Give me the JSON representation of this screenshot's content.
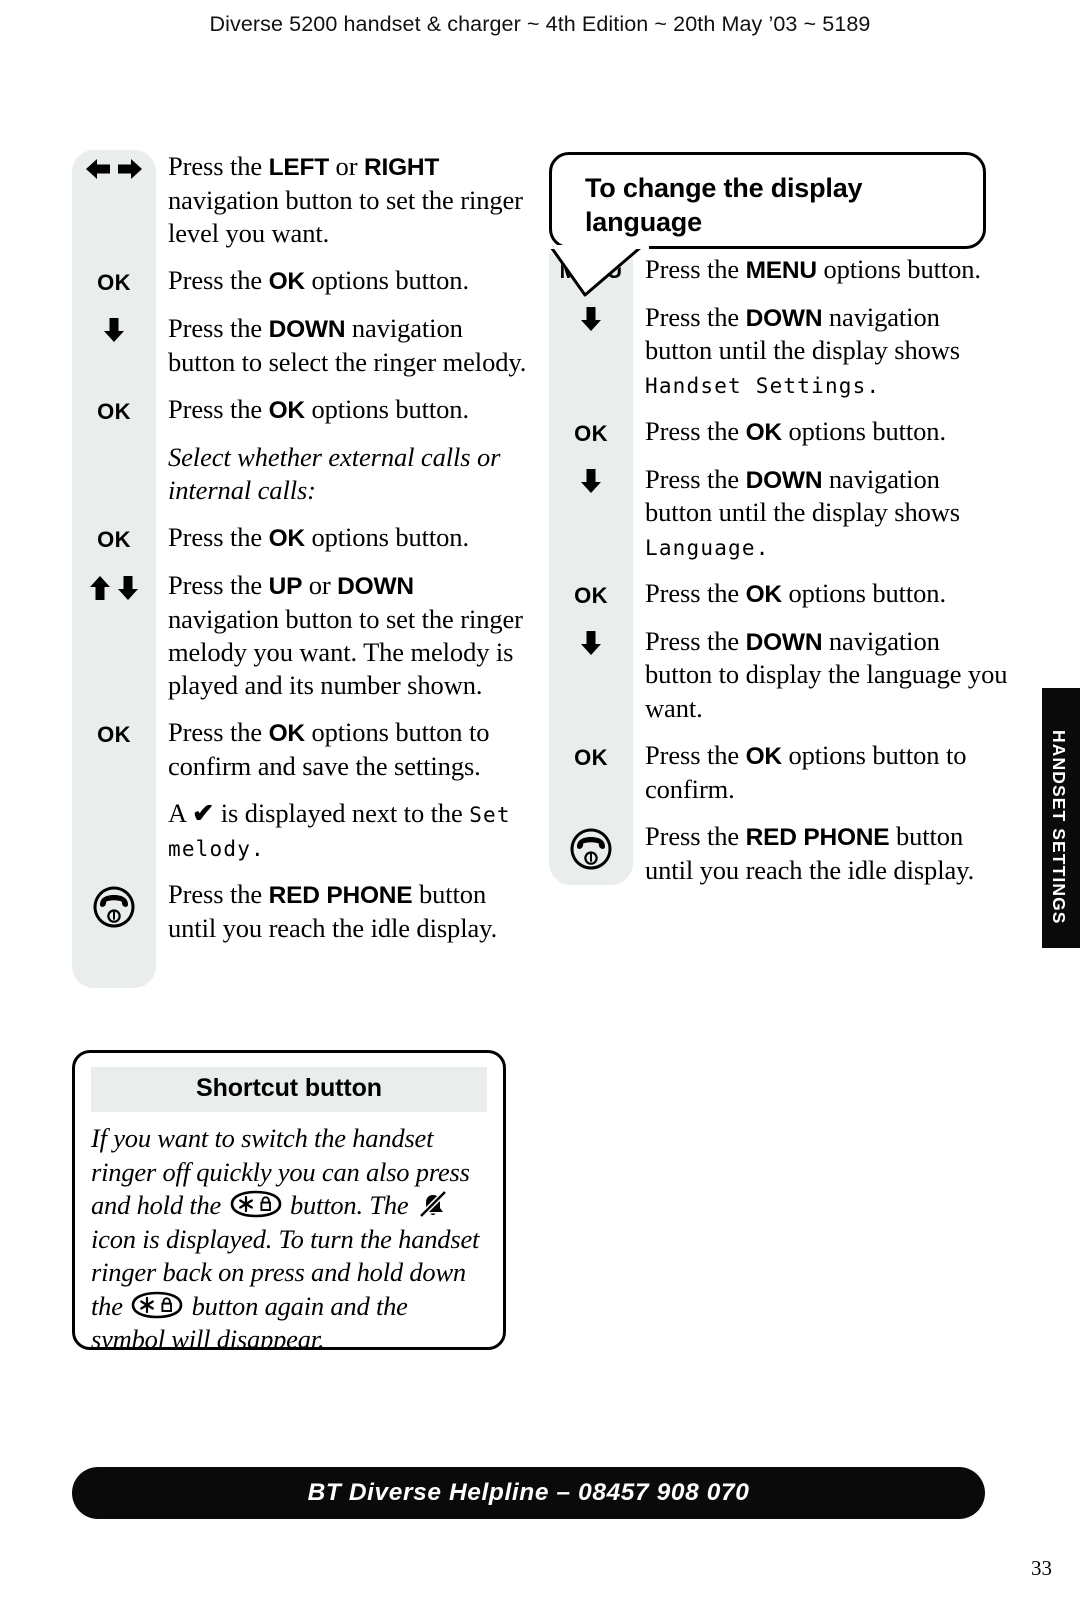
{
  "header": {
    "title": "Diverse 5200 handset & charger ~ 4th Edition ~ 20th May ’03 ~ 5189"
  },
  "side_tab": {
    "label": "HANDSET SETTINGS"
  },
  "footer": {
    "helpline": "BT Diverse Helpline – 08457 908 070",
    "page_number": "33"
  },
  "left_column": {
    "steps": [
      {
        "icon": "left-right-arrows-icon",
        "icon_label": "",
        "text_parts": [
          {
            "t": "Press the ",
            "s": "normal"
          },
          {
            "t": "LEFT",
            "s": "bold"
          },
          {
            "t": " or ",
            "s": "normal"
          },
          {
            "t": "RIGHT",
            "s": "bold"
          },
          {
            "t": " navigation button to set the ringer level you want.",
            "s": "normal"
          }
        ]
      },
      {
        "icon": "ok-label-icon",
        "icon_label": "OK",
        "text_parts": [
          {
            "t": "Press the ",
            "s": "normal"
          },
          {
            "t": "OK",
            "s": "bold"
          },
          {
            "t": " options button.",
            "s": "normal"
          }
        ]
      },
      {
        "icon": "down-arrow-icon",
        "icon_label": "",
        "text_parts": [
          {
            "t": "Press the ",
            "s": "normal"
          },
          {
            "t": "DOWN",
            "s": "bold"
          },
          {
            "t": " navigation button to select the ringer melody.",
            "s": "normal"
          }
        ]
      },
      {
        "icon": "ok-label-icon",
        "icon_label": "OK",
        "text_parts": [
          {
            "t": "Press the ",
            "s": "normal"
          },
          {
            "t": "OK",
            "s": "bold"
          },
          {
            "t": " options button.",
            "s": "normal"
          }
        ]
      },
      {
        "icon": "none",
        "icon_label": "",
        "text_parts": [
          {
            "t": "Select whether external calls or internal calls:",
            "s": "italic"
          }
        ]
      },
      {
        "icon": "ok-label-icon",
        "icon_label": "OK",
        "text_parts": [
          {
            "t": "Press the ",
            "s": "normal"
          },
          {
            "t": "OK",
            "s": "bold"
          },
          {
            "t": " options button.",
            "s": "normal"
          }
        ]
      },
      {
        "icon": "up-down-arrows-icon",
        "icon_label": "",
        "text_parts": [
          {
            "t": "Press the ",
            "s": "normal"
          },
          {
            "t": "UP",
            "s": "bold"
          },
          {
            "t": " or ",
            "s": "normal"
          },
          {
            "t": "DOWN",
            "s": "bold"
          },
          {
            "t": " navigation button to set the ringer melody you want. The melody is played and its number shown.",
            "s": "normal"
          }
        ]
      },
      {
        "icon": "ok-label-icon",
        "icon_label": "OK",
        "text_parts": [
          {
            "t": "Press the ",
            "s": "normal"
          },
          {
            "t": "OK",
            "s": "bold"
          },
          {
            "t": " options button to confirm and save the settings.",
            "s": "normal"
          }
        ]
      },
      {
        "icon": "none",
        "icon_label": "",
        "text_parts": [
          {
            "t": "A ",
            "s": "normal"
          },
          {
            "t": "✔",
            "s": "tick"
          },
          {
            "t": " is displayed next to the ",
            "s": "normal"
          },
          {
            "t": "Set melody.",
            "s": "lcd"
          }
        ]
      },
      {
        "icon": "red-phone-icon",
        "icon_label": "",
        "text_parts": [
          {
            "t": "Press the ",
            "s": "normal"
          },
          {
            "t": "RED PHONE",
            "s": "bold"
          },
          {
            "t": " button until you reach the idle display.",
            "s": "normal"
          }
        ]
      }
    ]
  },
  "right_column": {
    "callout_title": "To change the display language",
    "steps": [
      {
        "icon": "menu-label-icon",
        "icon_label": "MENU",
        "text_parts": [
          {
            "t": "Press the ",
            "s": "normal"
          },
          {
            "t": "MENU",
            "s": "bold"
          },
          {
            "t": " options button.",
            "s": "normal"
          }
        ]
      },
      {
        "icon": "down-arrow-icon",
        "icon_label": "",
        "text_parts": [
          {
            "t": "Press the ",
            "s": "normal"
          },
          {
            "t": "DOWN",
            "s": "bold"
          },
          {
            "t": " navigation button until the display shows ",
            "s": "normal"
          },
          {
            "t": "Handset Settings.",
            "s": "lcd"
          }
        ]
      },
      {
        "icon": "ok-label-icon",
        "icon_label": "OK",
        "text_parts": [
          {
            "t": "Press the ",
            "s": "normal"
          },
          {
            "t": "OK",
            "s": "bold"
          },
          {
            "t": " options button.",
            "s": "normal"
          }
        ]
      },
      {
        "icon": "down-arrow-icon",
        "icon_label": "",
        "text_parts": [
          {
            "t": "Press the ",
            "s": "normal"
          },
          {
            "t": "DOWN",
            "s": "bold"
          },
          {
            "t": " navigation button until the display shows ",
            "s": "normal"
          },
          {
            "t": "Language.",
            "s": "lcd"
          }
        ]
      },
      {
        "icon": "ok-label-icon",
        "icon_label": "OK",
        "text_parts": [
          {
            "t": "Press the ",
            "s": "normal"
          },
          {
            "t": "OK",
            "s": "bold"
          },
          {
            "t": " options button.",
            "s": "normal"
          }
        ]
      },
      {
        "icon": "down-arrow-icon",
        "icon_label": "",
        "text_parts": [
          {
            "t": "Press the ",
            "s": "normal"
          },
          {
            "t": "DOWN",
            "s": "bold"
          },
          {
            "t": " navigation button to display the language you want.",
            "s": "normal"
          }
        ]
      },
      {
        "icon": "ok-label-icon",
        "icon_label": "OK",
        "text_parts": [
          {
            "t": "Press the ",
            "s": "normal"
          },
          {
            "t": "OK",
            "s": "bold"
          },
          {
            "t": " options button to confirm.",
            "s": "normal"
          }
        ]
      },
      {
        "icon": "red-phone-icon",
        "icon_label": "",
        "text_parts": [
          {
            "t": "Press the ",
            "s": "normal"
          },
          {
            "t": "RED PHONE",
            "s": "bold"
          },
          {
            "t": " button until you reach the idle display.",
            "s": "normal"
          }
        ]
      }
    ]
  },
  "shortcut_box": {
    "title": "Shortcut button",
    "text_parts": [
      {
        "t": "If you want to switch the handset ringer off quickly you can also press and hold the ",
        "s": "italic"
      },
      {
        "t": "star-lock-key-icon",
        "s": "keyicon"
      },
      {
        "t": " button. The ",
        "s": "italic"
      },
      {
        "t": "ringer-off-bell-icon",
        "s": "bellicon"
      },
      {
        "t": " icon is displayed. To turn the handset ringer back on press and hold down the ",
        "s": "italic"
      },
      {
        "t": "star-lock-key-icon",
        "s": "keyicon"
      },
      {
        "t": " button again and the symbol will disappear.",
        "s": "italic"
      }
    ]
  },
  "colors": {
    "strip_grey": "#e9edec",
    "tab_black": "#0a0a0a",
    "text_black": "#000000",
    "page_white": "#ffffff"
  }
}
